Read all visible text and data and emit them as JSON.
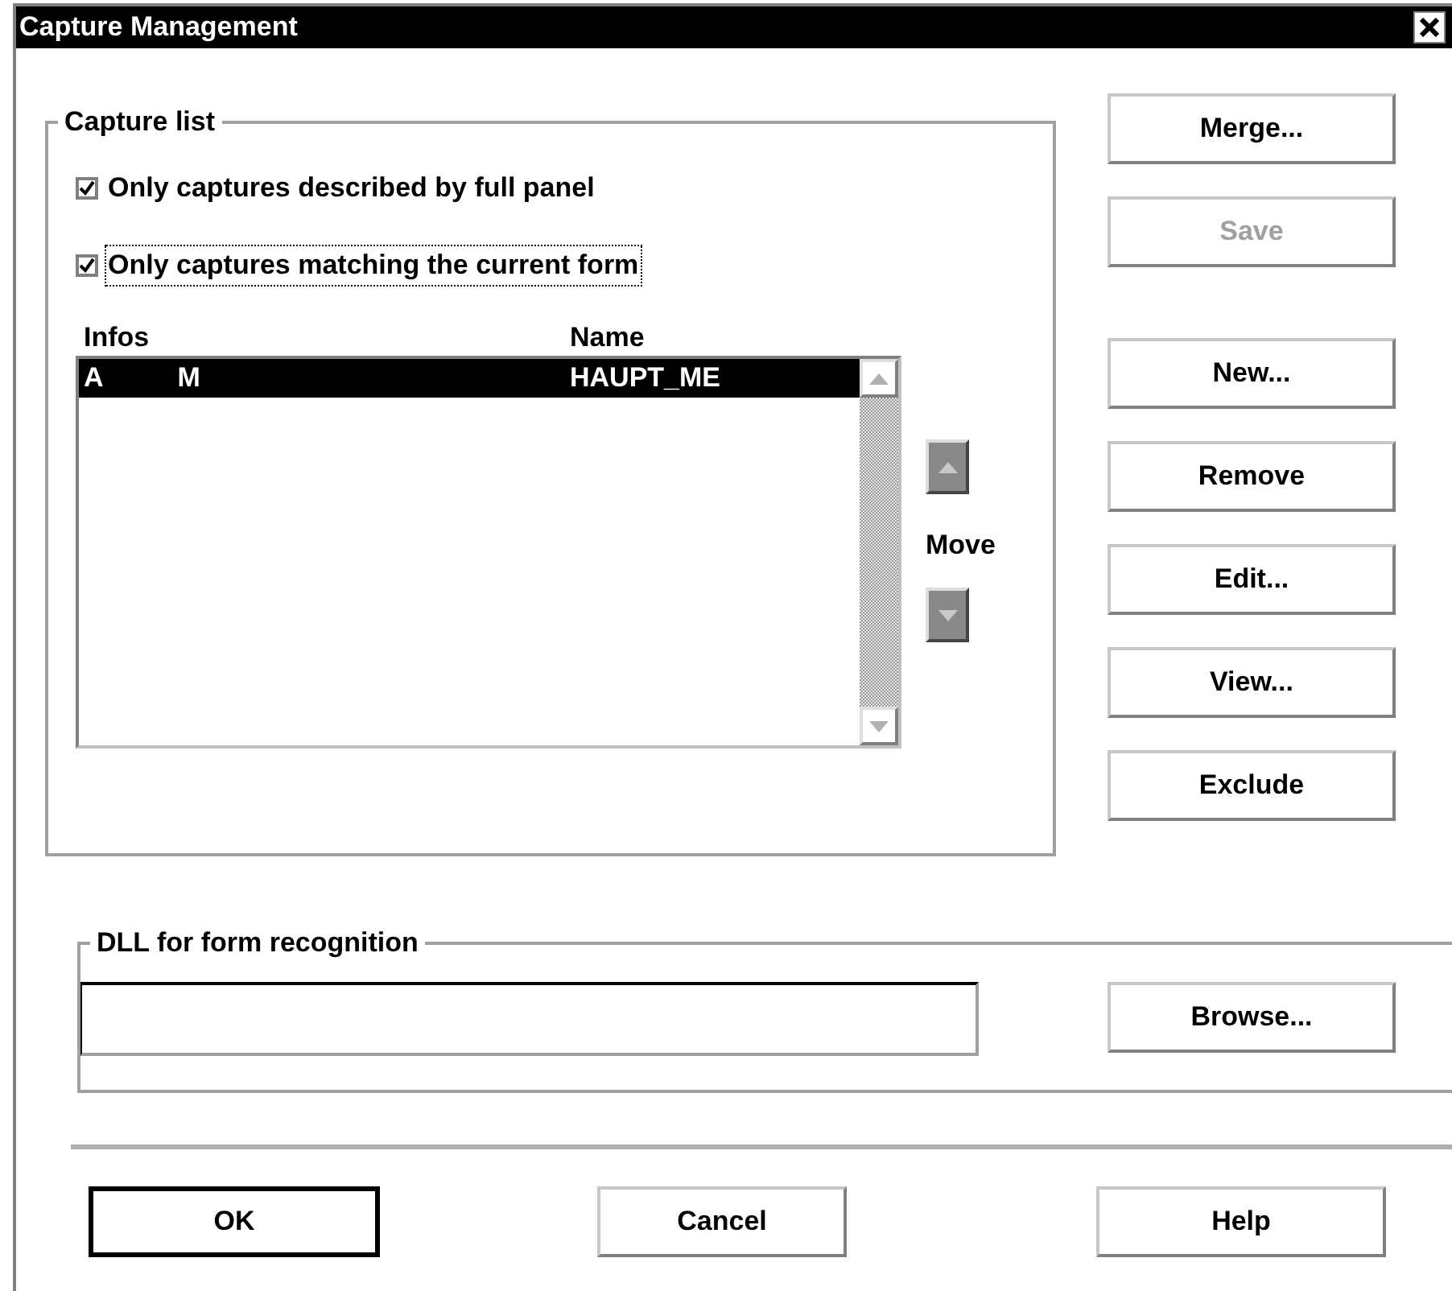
{
  "window": {
    "title": "Capture Management"
  },
  "capture_list": {
    "title": "Capture list",
    "filters": [
      {
        "label": "Only captures described by full panel",
        "checked": true,
        "focused": false
      },
      {
        "label": "Only captures matching the current form",
        "checked": true,
        "focused": true
      }
    ],
    "columns": [
      "Infos",
      "Name"
    ],
    "rows": [
      {
        "infos": [
          "A",
          "M"
        ],
        "name": "HAUPT_ME",
        "selected": true
      }
    ],
    "move_label": "Move"
  },
  "side_buttons": {
    "file_buttons": [
      {
        "label": "Merge...",
        "disabled": false
      },
      {
        "label": "Save",
        "disabled": true
      }
    ],
    "list_buttons": [
      {
        "label": "New...",
        "disabled": false
      },
      {
        "label": "Remove",
        "disabled": false
      },
      {
        "label": "Edit...",
        "disabled": false
      },
      {
        "label": "View...",
        "disabled": false
      },
      {
        "label": "Exclude",
        "disabled": false
      }
    ]
  },
  "dll": {
    "title": "DLL for form recognition",
    "browse_label": "Browse..."
  },
  "footer_buttons": [
    {
      "label": "OK",
      "default": true
    },
    {
      "label": "Cancel",
      "default": false
    },
    {
      "label": "Help",
      "default": false
    }
  ]
}
